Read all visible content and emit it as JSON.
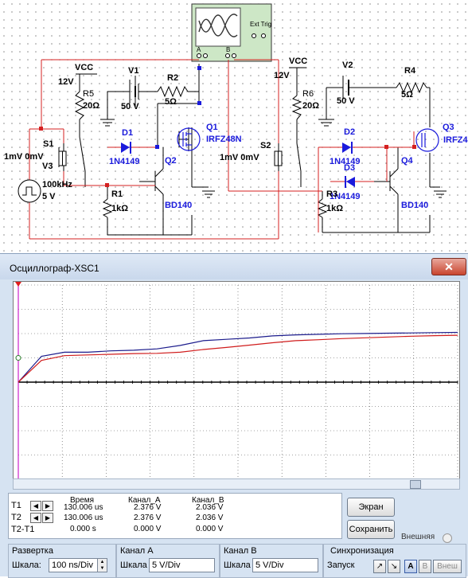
{
  "schematic": {
    "oscilloscope_ext_label": "Ext Trig",
    "osc_terminal_a": "A",
    "osc_terminal_b": "B",
    "left": {
      "vcc": "VCC",
      "vcc_value": "12V",
      "r5_name": "R5",
      "r5_value": "20Ω",
      "v1_name": "V1",
      "v1_value": "50 V",
      "r2_name": "R2",
      "r2_value": "5Ω",
      "q1_name": "Q1",
      "q1_part": "IRFZ48N",
      "d1_name": "D1",
      "d1_part": "1N4149",
      "q2_name": "Q2",
      "q2_part": "BD140",
      "s1_name": "S1",
      "v3_name": "V3",
      "v3_offset": "1mV 0mV",
      "v3_freq": "100kHz",
      "v3_amp": "5 V",
      "r1_name": "R1",
      "r1_value": "1kΩ"
    },
    "right": {
      "vcc": "VCC",
      "vcc_value": "12V",
      "r6_name": "R6",
      "r6_value": "20Ω",
      "v2_name": "V2",
      "v2_value": "50 V",
      "r4_name": "R4",
      "r4_value": "5Ω",
      "q3_name": "Q3",
      "q3_part": "IRFZ4",
      "d2_name": "D2",
      "d2_part": "1N4149",
      "d3_name": "D3",
      "d3_part": "1N4149",
      "q4_name": "Q4",
      "q4_part": "BD140",
      "s2_name": "S2",
      "s2_offset": "1mV 0mV",
      "r3_name": "R3",
      "r3_value": "1kΩ"
    }
  },
  "oscilloscope": {
    "title": "Осциллограф-XSC1",
    "close_symbol": "✕",
    "colors": {
      "channel_a": "#1c1c8c",
      "channel_b": "#d01c1c",
      "grid": "#4a4a4a",
      "cursor": "#cc22cc"
    },
    "chart_data": {
      "type": "line",
      "series": [
        {
          "name": "Канал_A",
          "color": "#1c1c8c",
          "values": [
            0.0,
            1.9,
            2.2,
            2.2,
            2.3,
            2.35,
            2.45,
            2.7,
            3.05,
            3.15,
            3.25,
            3.4,
            3.48,
            3.52,
            3.56,
            3.58,
            3.6,
            3.62,
            3.64,
            3.66
          ]
        },
        {
          "name": "Канал_B",
          "color": "#d01c1c",
          "values": [
            0.0,
            1.6,
            1.95,
            2.0,
            2.05,
            2.1,
            2.12,
            2.2,
            2.4,
            2.55,
            2.72,
            2.9,
            3.05,
            3.12,
            3.2,
            3.26,
            3.32,
            3.38,
            3.42,
            3.45
          ]
        }
      ],
      "x_divisions": 10,
      "y_divisions": 8,
      "grid": true
    },
    "readout": {
      "headers": {
        "time": "Время",
        "channel_a": "Канал_A",
        "channel_b": "Канал_B"
      },
      "rows": [
        {
          "label": "T1",
          "time": "130.006 us",
          "a": "2.376 V",
          "b": "2.036 V"
        },
        {
          "label": "T2",
          "time": "130.006 us",
          "a": "2.376 V",
          "b": "2.036 V"
        },
        {
          "label": "T2-T1",
          "time": "0.000 s",
          "a": "0.000 V",
          "b": "0.000 V"
        }
      ]
    },
    "buttons": {
      "screen": "Экран",
      "save": "Сохранить",
      "external": "Внешняя"
    },
    "timebase": {
      "title": "Развертка",
      "scale_label": "Шкала:",
      "scale_value": "100 ns/Div"
    },
    "channel_a": {
      "title": "Канал А",
      "scale_label": "Шкала",
      "scale_value": "5  V/Div"
    },
    "channel_b": {
      "title": "Канал В",
      "scale_label": "Шкала",
      "scale_value": "5  V/Div"
    },
    "trigger": {
      "title": "Синхронизация",
      "start_label": "Запуск",
      "edge_rise": "↗",
      "edge_fall": "↘",
      "src_a": "A",
      "src_b": "B",
      "src_ext": "Внеш"
    }
  }
}
